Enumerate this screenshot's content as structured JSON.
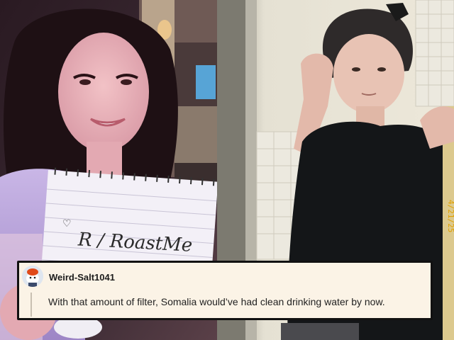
{
  "left_photo": {
    "sign_text": "R / RoastMe",
    "sign_heart": "♡"
  },
  "right_photo": {
    "timestamp": "4/21/25"
  },
  "comment": {
    "username": "Weird-Salt1041",
    "body": "With that amount of filter, Somalia would’ve had clean drinking water by now."
  }
}
